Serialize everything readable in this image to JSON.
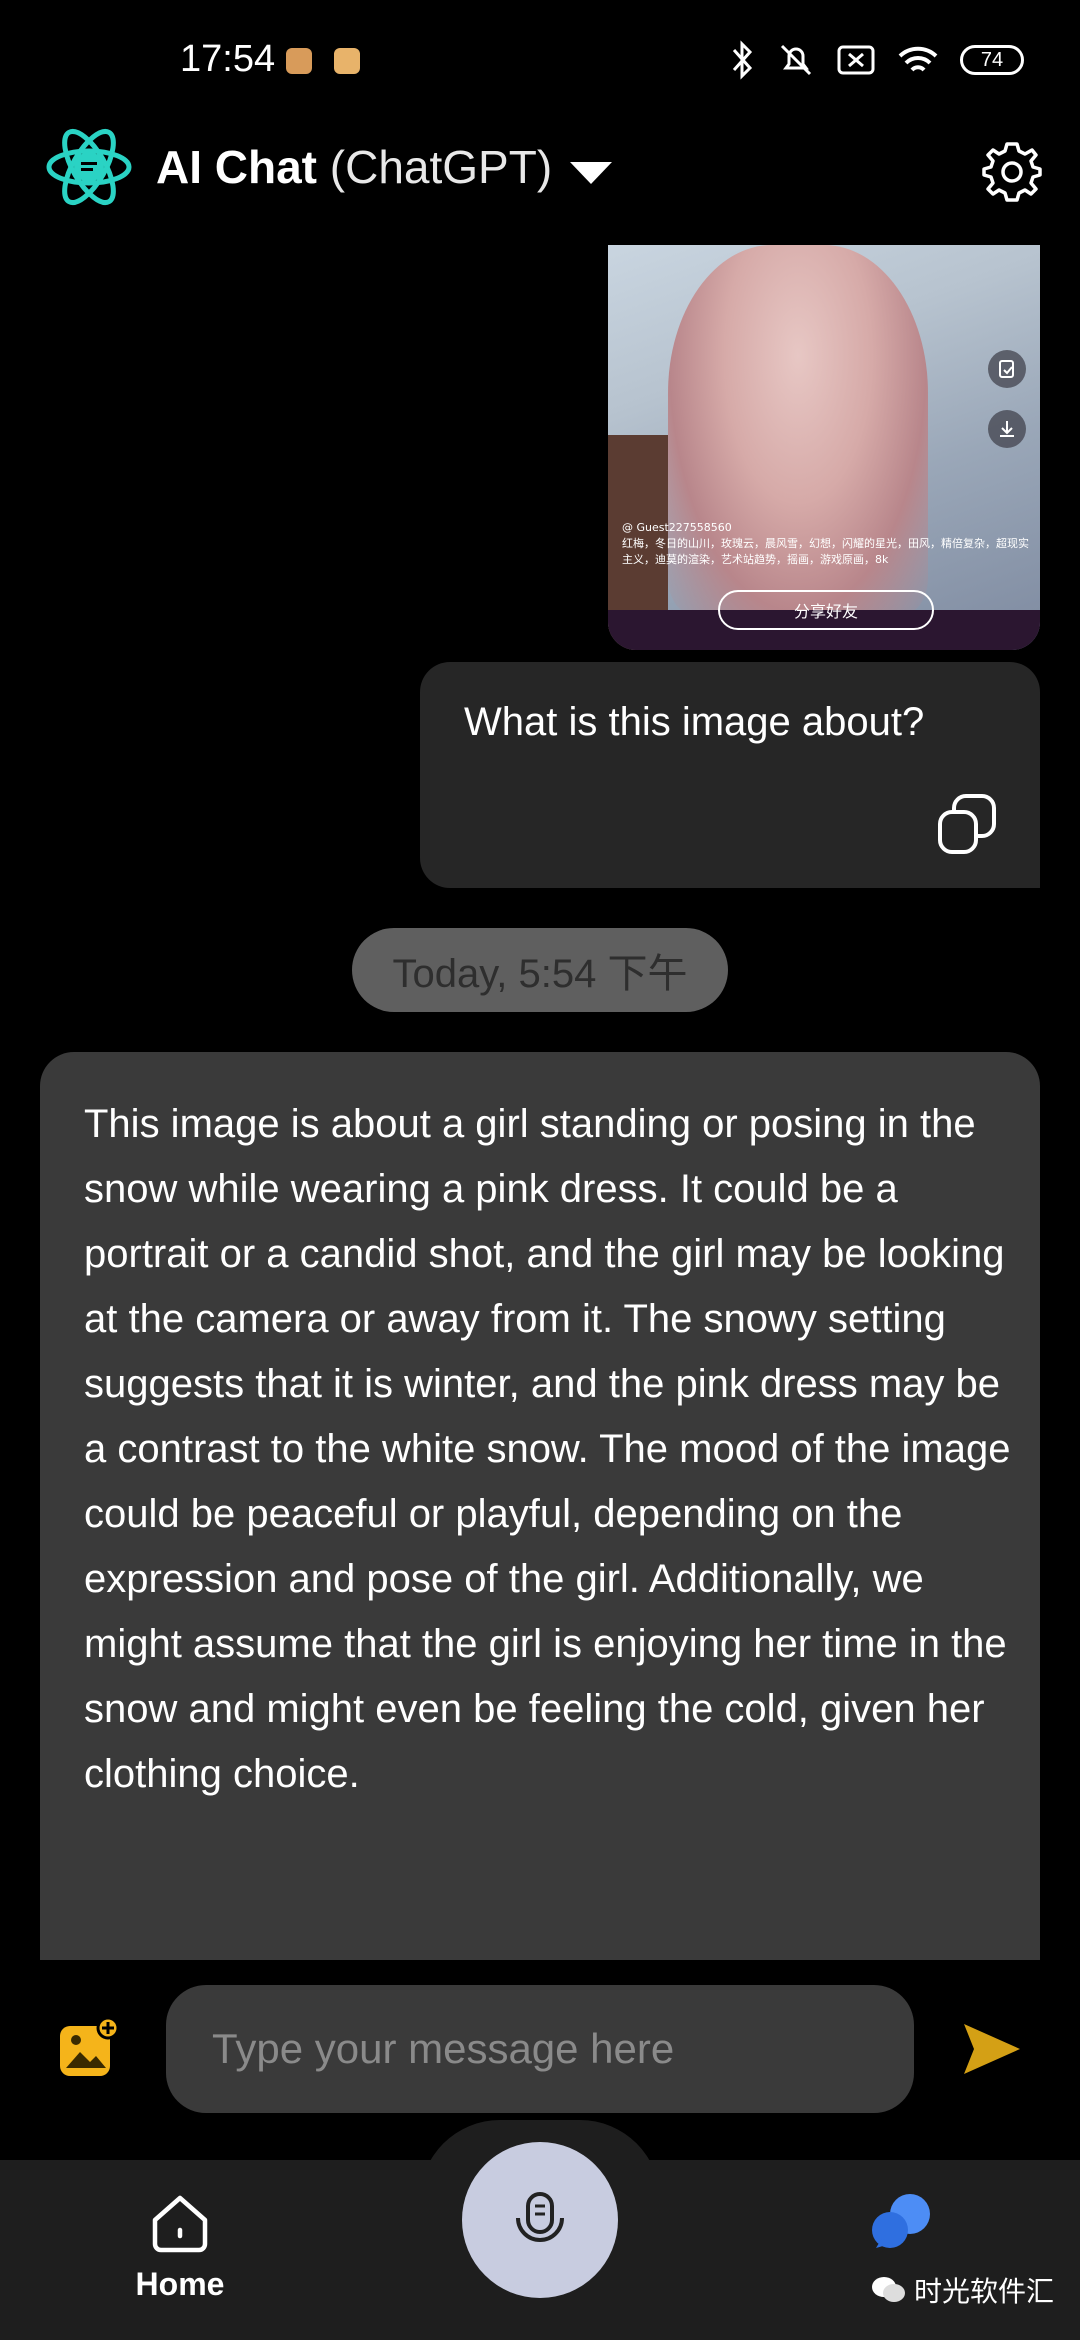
{
  "status_bar": {
    "time": "17:54",
    "battery": "74"
  },
  "header": {
    "title_bold": "AI Chat",
    "title_sub": " (ChatGPT)"
  },
  "sent_image": {
    "overlay_user": "@ Guest227558560",
    "overlay_tags": "红梅，冬日的山川，玫瑰云，晨风雪，幻想，闪耀的星光，田风，精倍复杂，超现实主义，迪莫的渲染，艺术站趋势，摇画，游戏原画，8k",
    "share_label": "分享好友"
  },
  "user_message": {
    "text": "What is this image about?"
  },
  "timestamp": "Today, 5:54 下午",
  "ai_message": {
    "text": "This image is about a girl standing or posing in the snow while wearing a pink dress. It could be a portrait or a candid shot, and the girl may be looking at the camera or away from it. The snowy setting suggests that it is winter, and the pink dress may be a contrast to the white snow. The mood of the image could be peaceful or playful, depending on the expression and pose of the girl. Additionally, we might assume that the girl is enjoying her time in the snow and might even be feeling the cold, given her clothing choice."
  },
  "composer": {
    "placeholder": "Type your message here"
  },
  "bottom_nav": {
    "home_label": "Home",
    "watermark": "时光软件汇"
  },
  "colors": {
    "accent_teal": "#2ad3c4",
    "accent_yellow": "#f5b41a",
    "chat_blue": "#4d8df5"
  },
  "icons": [
    "atom-logo-icon",
    "chevron-down-icon",
    "gear-icon",
    "copy-icon",
    "image-add-icon",
    "send-icon",
    "home-icon",
    "mic-icon",
    "chat-bubbles-icon",
    "wechat-icon"
  ]
}
